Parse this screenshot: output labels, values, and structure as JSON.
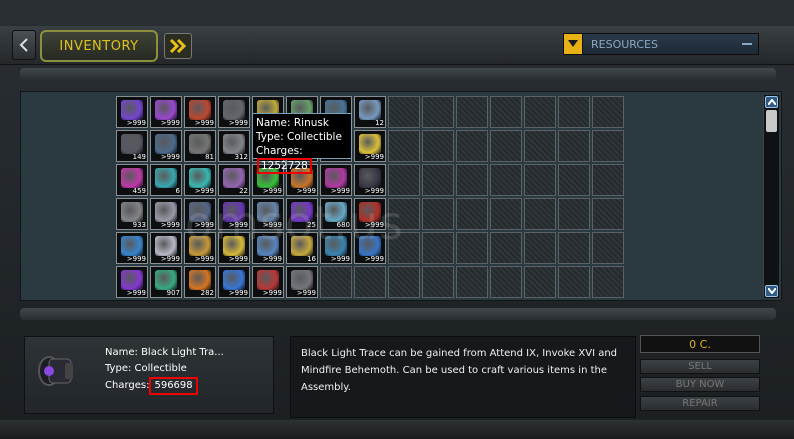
{
  "header": {
    "inventory_tab": "INVENTORY",
    "resources_dropdown": "RESOURCES"
  },
  "tooltip": {
    "name_label": "Name:",
    "name": "Rinusk",
    "type_label": "Type:",
    "type": "Collectible",
    "charges_label": "Charges:",
    "charges": "1252728"
  },
  "grid": {
    "rows": [
      [
        {
          "c": "#7a48d8",
          "n": ">999"
        },
        {
          "c": "#a04bd8",
          "n": ">999"
        },
        {
          "c": "#c84a32",
          "n": ">999"
        },
        {
          "c": "#6a6a72",
          "n": ">999"
        },
        {
          "c": "#c8b23a",
          "n": ">999"
        },
        {
          "c": "#6aa870",
          "n": ">999"
        },
        {
          "c": "#4b78a0",
          "n": ">999"
        },
        {
          "c": "#7da0c8",
          "n": "12"
        }
      ],
      [
        {
          "c": "#5a5a66",
          "n": "149"
        },
        {
          "c": "#4f6e90",
          "n": ">999"
        },
        {
          "c": "#7b7b7b",
          "n": "81"
        },
        {
          "c": "#8a8a92",
          "n": "312"
        },
        {
          "c": "#2a5a8a",
          "n": ">999"
        },
        {
          "c": "#3a6ab0",
          "n": ">999"
        },
        {
          "c": "#d23a3a",
          "n": ">999"
        },
        {
          "c": "#e6c83c",
          "n": ">999"
        }
      ],
      [
        {
          "c": "#c83ab0",
          "n": "459"
        },
        {
          "c": "#3ab0b8",
          "n": "6"
        },
        {
          "c": "#3ac0b8",
          "n": ">999"
        },
        {
          "c": "#9a6ab8",
          "n": "22"
        },
        {
          "c": "#3ac83a",
          "n": ">999"
        },
        {
          "c": "#d07a2a",
          "n": ">999"
        },
        {
          "c": "#b83aa8",
          "n": ">999"
        },
        {
          "c": "#3a3a48",
          "n": ">999"
        }
      ],
      [
        {
          "c": "#8a8a90",
          "n": "933"
        },
        {
          "c": "#a0a0b0",
          "n": ">999"
        },
        {
          "c": "#5a6a8a",
          "n": ">999"
        },
        {
          "c": "#6a3ab8",
          "n": ">999"
        },
        {
          "c": "#6a8ab0",
          "n": ">999"
        },
        {
          "c": "#7a3ad0",
          "n": "25"
        },
        {
          "c": "#6ab0d0",
          "n": "680"
        },
        {
          "c": "#b8322a",
          "n": ">999"
        }
      ],
      [
        {
          "c": "#3a8ad8",
          "n": ">999"
        },
        {
          "c": "#c0c0d0",
          "n": ">999"
        },
        {
          "c": "#d0a03a",
          "n": ">999"
        },
        {
          "c": "#e0c23a",
          "n": ">999"
        },
        {
          "c": "#5a8ac8",
          "n": ">999"
        },
        {
          "c": "#d0b040",
          "n": "16"
        },
        {
          "c": "#3a8ab8",
          "n": ">999"
        },
        {
          "c": "#3a7ad0",
          "n": ">999"
        }
      ],
      [
        {
          "c": "#8a3ad8",
          "n": ">999"
        },
        {
          "c": "#3ab088",
          "n": "907"
        },
        {
          "c": "#e07a22",
          "n": "282"
        },
        {
          "c": "#3a7ae0",
          "n": ">999"
        },
        {
          "c": "#c03a3a",
          "n": ">999"
        },
        {
          "c": "#7a7a82",
          "n": ">999"
        }
      ]
    ]
  },
  "detail": {
    "name_label": "Name:",
    "name": "Black Light Tra...",
    "type_label": "Type:",
    "type": "Collectible",
    "charges_label": "Charges:",
    "charges": "596698"
  },
  "description": "Black Light Trace can be gained from Attend IX, Invoke XVI and Mindfire Behemoth. Can be used to craft various items in the Assembly.",
  "shop": {
    "credits": "0 C.",
    "sell": "SELL",
    "buy_now": "BUY NOW",
    "repair": "REPAIR"
  },
  "watermark": "omsot.us",
  "colors": {
    "accent_yellow": "#e0c21c",
    "highlight_red": "#e00000",
    "grid_panel": "#2b3a40"
  }
}
